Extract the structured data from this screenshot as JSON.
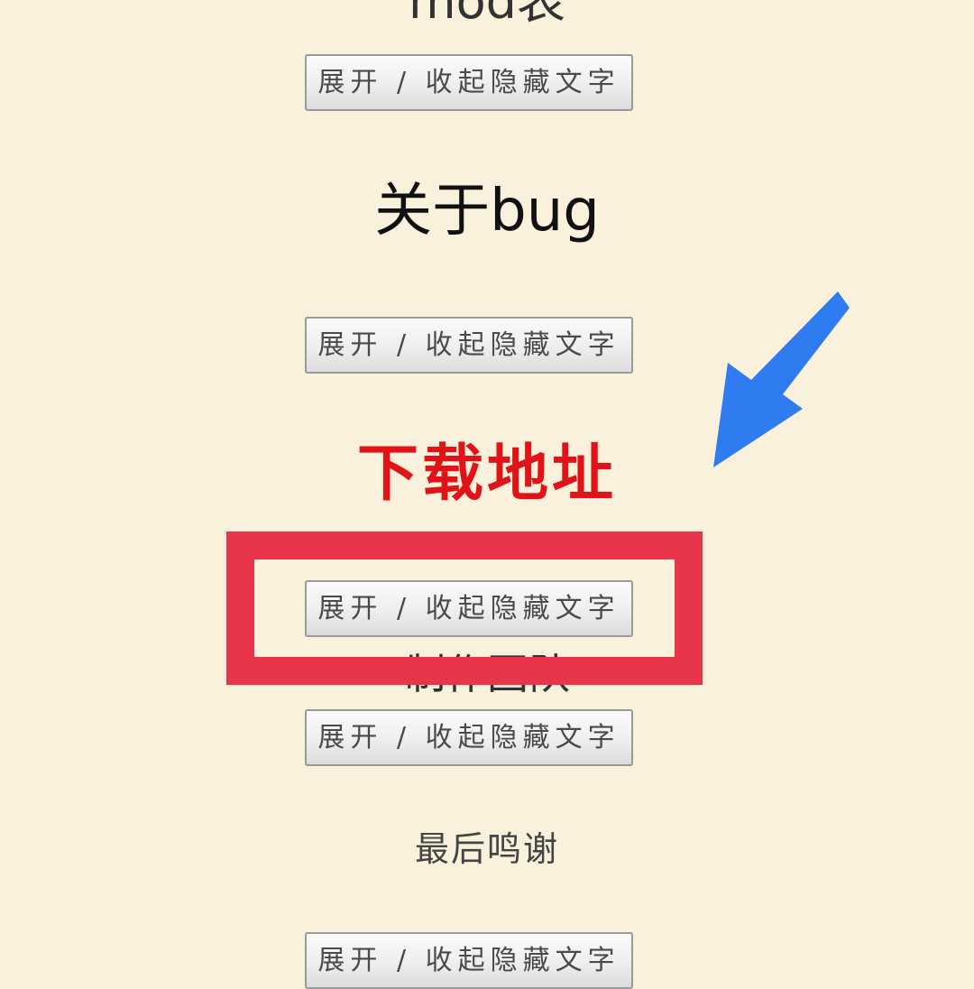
{
  "sections": {
    "mod_heading": "mod表",
    "bug_heading": "关于bug",
    "download_heading": "下载地址",
    "team_heading": "制作团队",
    "thanks_heading": "最后鸣谢"
  },
  "buttons": {
    "toggle_label": "展开 / 收起隐藏文字"
  },
  "colors": {
    "background": "#f9f1dc",
    "download_heading": "#e01418",
    "highlight_box": "#e8354a",
    "arrow": "#2f7bf0"
  },
  "annotations": {
    "arrow_icon": "arrow-down-left-icon",
    "highlight": "red-rectangle-highlight"
  }
}
